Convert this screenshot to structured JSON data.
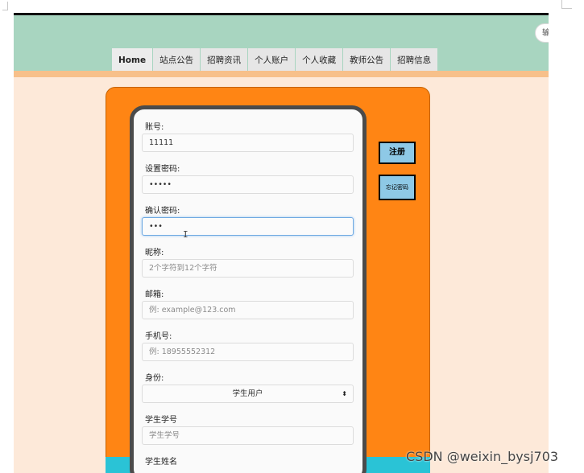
{
  "header": {
    "search_text": "输"
  },
  "nav": {
    "items": [
      {
        "label": "Home"
      },
      {
        "label": "站点公告"
      },
      {
        "label": "招聘资讯"
      },
      {
        "label": "个人账户"
      },
      {
        "label": "个人收藏"
      },
      {
        "label": "教师公告"
      },
      {
        "label": "招聘信息"
      }
    ]
  },
  "form": {
    "account": {
      "label": "账号:",
      "value": "11111"
    },
    "password": {
      "label": "设置密码:",
      "value": "•••••"
    },
    "confirm": {
      "label": "确认密码:",
      "value": "•••"
    },
    "nickname": {
      "label": "昵称:",
      "placeholder": "2个字符到12个字符"
    },
    "email": {
      "label": "邮箱:",
      "placeholder": "例: example@123.com"
    },
    "phone": {
      "label": "手机号:",
      "placeholder": "例: 18955552312"
    },
    "role": {
      "label": "身份:",
      "selected": "学生用户"
    },
    "student_id": {
      "label": "学生学号",
      "placeholder": "学生学号"
    },
    "student_name": {
      "label": "学生姓名"
    }
  },
  "buttons": {
    "register": "注册",
    "forgot": "忘记密码"
  },
  "watermark": "CSDN @weixin_bysj703",
  "colors": {
    "header_bg": "#a8d5c0",
    "page_bg": "#fde9d9",
    "panel_orange": "#ff8514",
    "button_blue": "#8ec9e6"
  }
}
